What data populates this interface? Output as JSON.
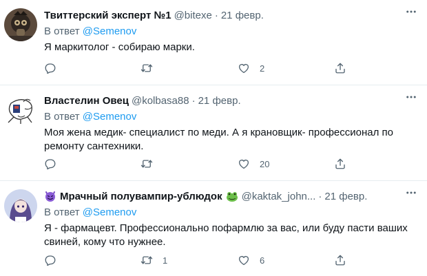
{
  "tweets": [
    {
      "author_name": "Твиттерский эксперт №1",
      "handle": "@bitexe",
      "dot": "·",
      "time": "21 февр.",
      "reply_prefix": "В ответ",
      "reply_to": "@Semenov",
      "text": "Я маркитолог - собираю марки.",
      "reply_count": "",
      "retweet_count": "",
      "like_count": "2"
    },
    {
      "author_name": "Властелин Овец",
      "handle": "@kolbasa88",
      "dot": "·",
      "time": "21 февр.",
      "reply_prefix": "В ответ",
      "reply_to": "@Semenov",
      "text": "Моя жена медик- специалист по меди. А я крановщик- профессионал по ремонту сантехники.",
      "reply_count": "",
      "retweet_count": "",
      "like_count": "20"
    },
    {
      "author_name": "Мрачный полувампир-ублюдок",
      "handle": "@kaktak_john...",
      "dot": "·",
      "time": "21 февр.",
      "reply_prefix": "В ответ",
      "reply_to": "@Semenov",
      "text": "Я - фармацевт. Профессионально пофармлю за вас, или буду пасти ваших свиней, кому что нужнее.",
      "reply_count": "",
      "retweet_count": "1",
      "like_count": "6"
    }
  ],
  "icons": {
    "more": "more-horizontal-icon",
    "reply": "reply-icon",
    "retweet": "retweet-icon",
    "like": "heart-icon",
    "share": "share-icon"
  },
  "colors": {
    "accent": "#1d9bf0",
    "secondary_text": "#536471",
    "primary_text": "#0f1419",
    "divider": "#e6ecf0"
  }
}
